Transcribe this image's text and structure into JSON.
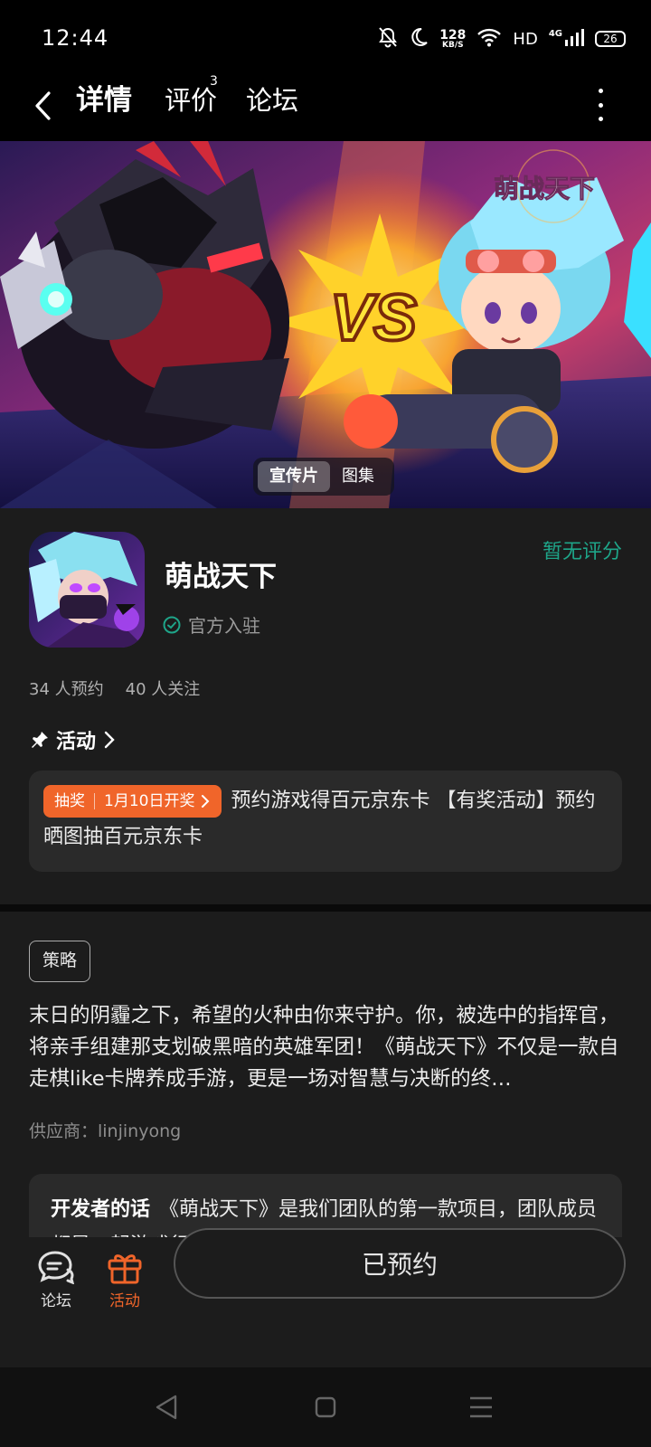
{
  "status_bar": {
    "time": "12:44",
    "net_speed_value": "128",
    "net_speed_unit": "KB/S",
    "hd": "HD",
    "network": "4G",
    "battery": "26",
    "icons": [
      "mute-bell-icon",
      "moon-icon",
      "wifi-icon",
      "signal-icon",
      "battery-icon"
    ]
  },
  "nav": {
    "tabs": [
      {
        "label": "详情",
        "active": true
      },
      {
        "label": "评价",
        "badge": "3"
      },
      {
        "label": "论坛"
      }
    ]
  },
  "banner": {
    "title_art": "萌战天下",
    "vs_text": "VS",
    "media_options": [
      "宣传片",
      "图集"
    ],
    "active_media": "宣传片"
  },
  "app": {
    "name": "萌战天下",
    "rating": "暂无评分",
    "verified": "官方入驻",
    "reservations": "34 人预约",
    "followers": "40 人关注"
  },
  "activity": {
    "heading": "活动",
    "badge_type": "抽奖",
    "badge_date": "1月10日开奖",
    "text": "预约游戏得百元京东卡 【有奖活动】预约晒图抽百元京东卡"
  },
  "description": {
    "tag": "策略",
    "text": "末日的阴霾之下，希望的火种由你来守护。你，被选中的指挥官，将亲手组建那支划破黑暗的英雄军团！《萌战天下》不仅是一款自走棋like卡牌养成手游，更是一场对智慧与决断的终…",
    "supplier": "供应商：linjinyong",
    "dev_label": "开发者的话",
    "dev_text": "《萌战天下》是我们团队的第一款项目，团队成员都是一起游戏行业打拼的一群为了共同梦想而聚在一起的…"
  },
  "bottom_bar": {
    "forum_label": "论坛",
    "activity_label": "活动",
    "reserve_label": "已预约"
  },
  "colors": {
    "accent": "#1ea589",
    "orange": "#f0652a",
    "panel": "#1c1c1c"
  }
}
